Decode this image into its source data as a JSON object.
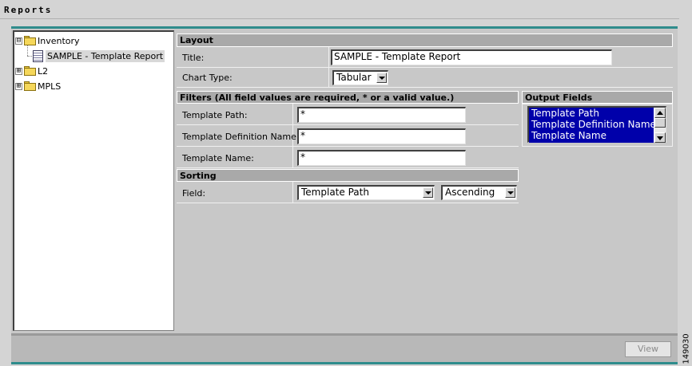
{
  "window": {
    "title": "Reports"
  },
  "tree": {
    "items": [
      {
        "label": "Inventory",
        "expander": "⊟"
      },
      {
        "label": "SAMPLE - Template Report"
      },
      {
        "label": "L2",
        "expander": "⊞"
      },
      {
        "label": "MPLS",
        "expander": "⊞"
      }
    ]
  },
  "layout": {
    "heading": "Layout",
    "title_label": "Title:",
    "title_value": "SAMPLE - Template Report",
    "chart_type_label": "Chart Type:",
    "chart_type_value": "Tabular"
  },
  "filters": {
    "heading": "Filters (All field values are required, * or a valid value.)",
    "fields": [
      {
        "label": "Template Path:",
        "value": "*"
      },
      {
        "label": "Template Definition Name:",
        "value": "*"
      },
      {
        "label": "Template Name:",
        "value": "*"
      }
    ]
  },
  "sorting": {
    "heading": "Sorting",
    "field_label": "Field:",
    "field_value": "Template Path",
    "order_value": "Ascending"
  },
  "output_fields": {
    "heading": "Output Fields",
    "items": [
      "Template Path",
      "Template Definition Name",
      "Template Name"
    ]
  },
  "footer": {
    "view_label": "View"
  },
  "figure_number": "149030",
  "colors": {
    "accent": "#2f8c8c",
    "selection": "#0000aa",
    "header": "#a9a9a9"
  }
}
